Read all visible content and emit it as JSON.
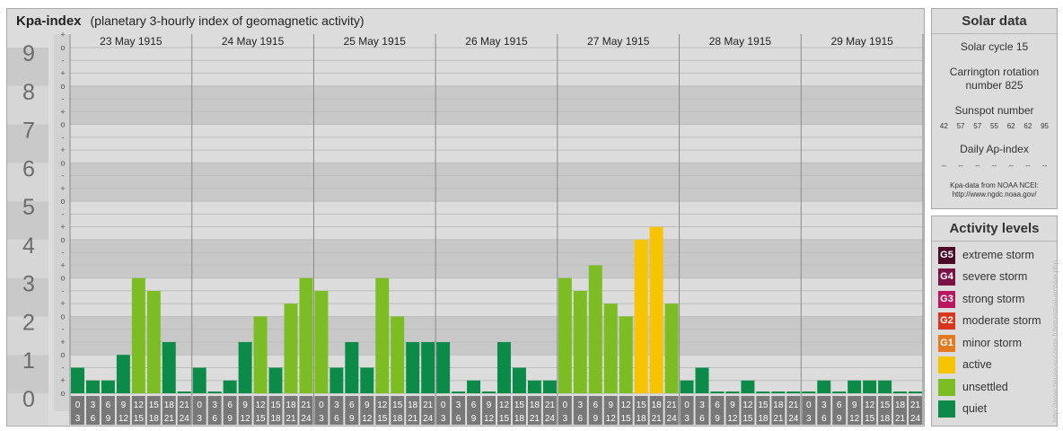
{
  "header": {
    "title": "Kpa-index",
    "subtitle": "(planetary 3-hourly index of geomagnetic activity)"
  },
  "chart_data": {
    "type": "bar",
    "title": "Kpa-index",
    "subtitle": "(planetary 3-hourly index of geomagnetic activity)",
    "ylim": [
      0,
      9
    ],
    "y_ticks": [
      "0",
      "1",
      "2",
      "3",
      "4",
      "5",
      "6",
      "7",
      "8",
      "9"
    ],
    "y_sub_ticks": [
      "-",
      "o",
      "+"
    ],
    "days": [
      "23 May 1915",
      "24 May 1915",
      "25 May 1915",
      "26 May 1915",
      "27 May 1915",
      "28 May 1915",
      "29 May 1915"
    ],
    "interval_labels": [
      [
        "0",
        "3"
      ],
      [
        "3",
        "6"
      ],
      [
        "6",
        "9"
      ],
      [
        "9",
        "12"
      ],
      [
        "12",
        "15"
      ],
      [
        "15",
        "18"
      ],
      [
        "18",
        "21"
      ],
      [
        "21",
        "24"
      ]
    ],
    "values": [
      [
        0.667,
        0.333,
        0.333,
        1.0,
        3.0,
        2.667,
        1.333,
        0.0
      ],
      [
        0.667,
        0.0,
        0.333,
        1.333,
        2.0,
        0.667,
        2.333,
        3.0
      ],
      [
        2.667,
        0.667,
        1.333,
        0.667,
        3.0,
        2.0,
        1.333,
        1.333
      ],
      [
        1.333,
        0.0,
        0.333,
        0.0,
        1.333,
        0.667,
        0.333,
        0.333
      ],
      [
        3.0,
        2.667,
        3.333,
        2.333,
        2.0,
        4.0,
        4.333,
        2.333
      ],
      [
        0.333,
        0.667,
        0.0,
        0.0,
        0.333,
        0.0,
        0.0,
        0.0
      ],
      [
        0.0,
        0.333,
        0.0,
        0.333,
        0.333,
        0.333,
        0.0,
        0.0
      ]
    ],
    "level_colors": {
      "quiet": "#0c8b48",
      "unsettled": "#7bbd22",
      "active": "#f6c400"
    },
    "grid": true
  },
  "solar": {
    "title": "Solar data",
    "solar_cycle": "Solar cycle 15",
    "carrington_line1": "Carrington rotation",
    "carrington_line2": "number 825",
    "sunspot_label": "Sunspot number",
    "sunspot_values": [
      "42",
      "57",
      "57",
      "55",
      "62",
      "62",
      "95"
    ],
    "ap_label": "Daily Ap-index",
    "ap_values": [
      "--",
      "--",
      "--",
      "--",
      "--",
      "--",
      "--"
    ],
    "source_line1": "Kpa-data from NOAA NCEI:",
    "source_line2": "http://www.ngdc.noaa.gov/"
  },
  "activity": {
    "title": "Activity levels",
    "items": [
      {
        "badge": "G5",
        "label": "extreme storm",
        "color": "#4a0a2a"
      },
      {
        "badge": "G4",
        "label": "severe storm",
        "color": "#7a1245"
      },
      {
        "badge": "G3",
        "label": "strong storm",
        "color": "#b7175e"
      },
      {
        "badge": "G2",
        "label": "moderate storm",
        "color": "#d8361e"
      },
      {
        "badge": "G1",
        "label": "minor storm",
        "color": "#e5791f"
      },
      {
        "badge": "",
        "label": "active",
        "color": "#f6c400"
      },
      {
        "badge": "",
        "label": "unsettled",
        "color": "#7bbd22"
      },
      {
        "badge": "",
        "label": "quiet",
        "color": "#0c8b48"
      }
    ]
  },
  "watermark": "http://www.tieuse-sur-terre.fr/terrestrial-archive.php"
}
